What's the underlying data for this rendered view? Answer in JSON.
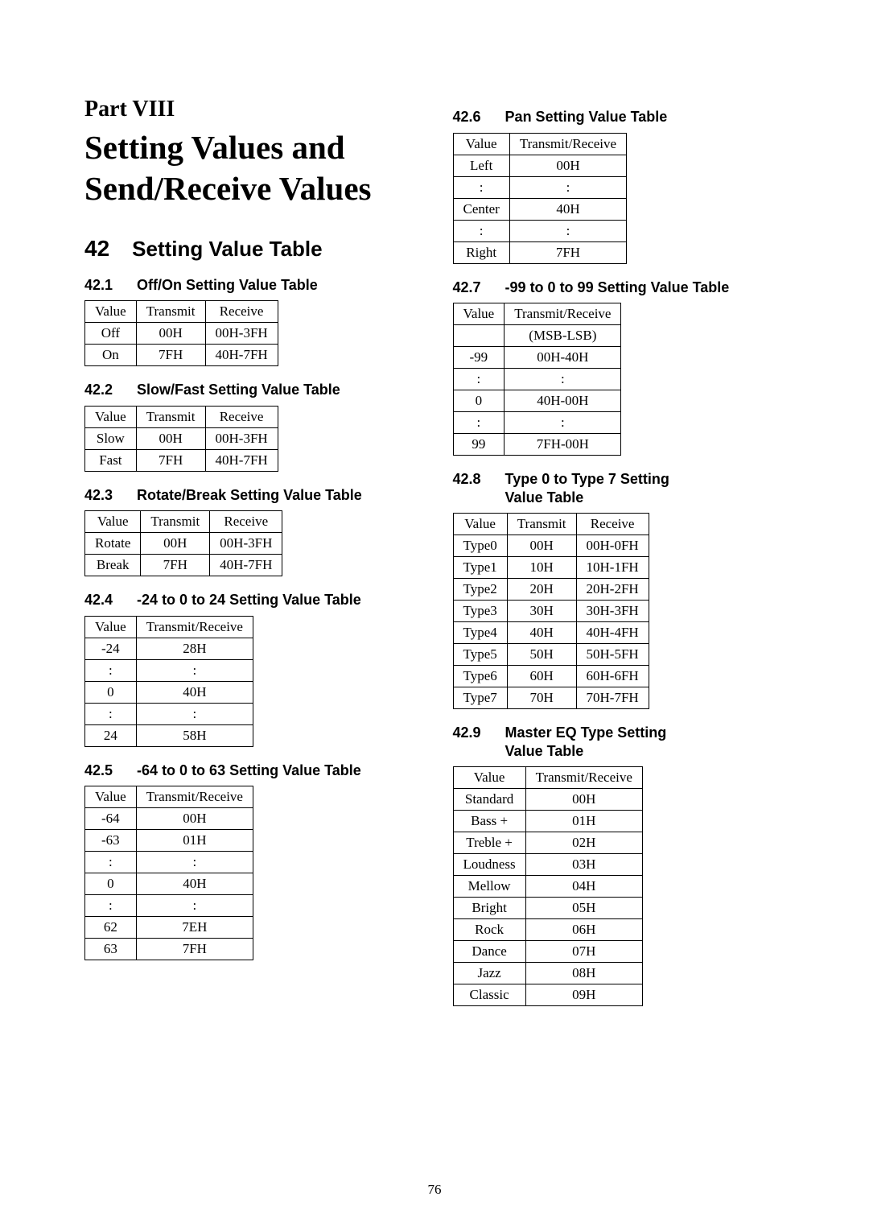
{
  "page_number": "76",
  "part": {
    "label": "Part VIII",
    "title_l1": "Setting Values and",
    "title_l2": "Send/Receive Values"
  },
  "section": {
    "num": "42",
    "title": "Setting Value Table"
  },
  "subs": {
    "s4201": {
      "num": "42.1",
      "title": "Off/On Setting Value Table",
      "headers": [
        "Value",
        "Transmit",
        "Receive"
      ],
      "rows": [
        [
          "Off",
          "00H",
          "00H-3FH"
        ],
        [
          "On",
          "7FH",
          "40H-7FH"
        ]
      ]
    },
    "s4202": {
      "num": "42.2",
      "title": "Slow/Fast Setting Value Table",
      "headers": [
        "Value",
        "Transmit",
        "Receive"
      ],
      "rows": [
        [
          "Slow",
          "00H",
          "00H-3FH"
        ],
        [
          "Fast",
          "7FH",
          "40H-7FH"
        ]
      ]
    },
    "s4203": {
      "num": "42.3",
      "title": "Rotate/Break Setting Value Table",
      "headers": [
        "Value",
        "Transmit",
        "Receive"
      ],
      "rows": [
        [
          "Rotate",
          "00H",
          "00H-3FH"
        ],
        [
          "Break",
          "7FH",
          "40H-7FH"
        ]
      ]
    },
    "s4204": {
      "num": "42.4",
      "title": "-24 to 0 to 24 Setting Value Table",
      "headers": [
        "Value",
        "Transmit/Receive"
      ],
      "rows": [
        [
          "-24",
          "28H"
        ],
        [
          ":",
          ":"
        ],
        [
          "0",
          "40H"
        ],
        [
          ":",
          ":"
        ],
        [
          "24",
          "58H"
        ]
      ]
    },
    "s4205": {
      "num": "42.5",
      "title": "-64 to 0 to 63 Setting Value Table",
      "headers": [
        "Value",
        "Transmit/Receive"
      ],
      "rows": [
        [
          "-64",
          "00H"
        ],
        [
          "-63",
          "01H"
        ],
        [
          ":",
          ":"
        ],
        [
          "0",
          "40H"
        ],
        [
          ":",
          ":"
        ],
        [
          "62",
          "7EH"
        ],
        [
          "63",
          "7FH"
        ]
      ]
    },
    "s4206": {
      "num": "42.6",
      "title": "Pan Setting Value Table",
      "headers": [
        "Value",
        "Transmit/Receive"
      ],
      "rows": [
        [
          "Left",
          "00H"
        ],
        [
          ":",
          ":"
        ],
        [
          "Center",
          "40H"
        ],
        [
          ":",
          ":"
        ],
        [
          "Right",
          "7FH"
        ]
      ]
    },
    "s4207": {
      "num": "42.7",
      "title": "-99 to 0 to 99 Setting Value Table",
      "headers": [
        "Value",
        "Transmit/Receive"
      ],
      "subheader": "(MSB-LSB)",
      "rows": [
        [
          "-99",
          "00H-40H"
        ],
        [
          ":",
          ":"
        ],
        [
          "0",
          "40H-00H"
        ],
        [
          ":",
          ":"
        ],
        [
          "99",
          "7FH-00H"
        ]
      ]
    },
    "s4208": {
      "num": "42.8",
      "title_l1": "Type 0 to Type 7 Setting",
      "title_l2": "Value Table",
      "headers": [
        "Value",
        "Transmit",
        "Receive"
      ],
      "rows": [
        [
          "Type0",
          "00H",
          "00H-0FH"
        ],
        [
          "Type1",
          "10H",
          "10H-1FH"
        ],
        [
          "Type2",
          "20H",
          "20H-2FH"
        ],
        [
          "Type3",
          "30H",
          "30H-3FH"
        ],
        [
          "Type4",
          "40H",
          "40H-4FH"
        ],
        [
          "Type5",
          "50H",
          "50H-5FH"
        ],
        [
          "Type6",
          "60H",
          "60H-6FH"
        ],
        [
          "Type7",
          "70H",
          "70H-7FH"
        ]
      ]
    },
    "s4209": {
      "num": "42.9",
      "title_l1": "Master EQ Type Setting",
      "title_l2": "Value Table",
      "headers": [
        "Value",
        "Transmit/Receive"
      ],
      "rows": [
        [
          "Standard",
          "00H"
        ],
        [
          "Bass +",
          "01H"
        ],
        [
          "Treble +",
          "02H"
        ],
        [
          "Loudness",
          "03H"
        ],
        [
          "Mellow",
          "04H"
        ],
        [
          "Bright",
          "05H"
        ],
        [
          "Rock",
          "06H"
        ],
        [
          "Dance",
          "07H"
        ],
        [
          "Jazz",
          "08H"
        ],
        [
          "Classic",
          "09H"
        ]
      ]
    }
  }
}
